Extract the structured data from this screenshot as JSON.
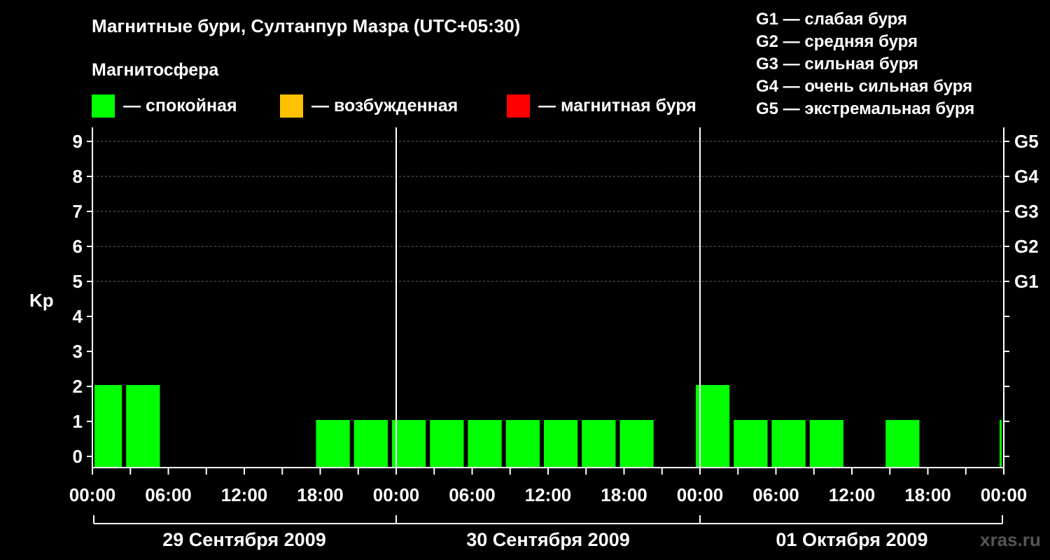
{
  "title": "Магнитные бури, Султанпур Мазра (UTC+05:30)",
  "subtitle": "Магнитосфера",
  "legend": [
    {
      "label": "— спокойная",
      "color": "#00ff00"
    },
    {
      "label": "— возбужденная",
      "color": "#ffc000"
    },
    {
      "label": "— магнитная буря",
      "color": "#ff0000"
    }
  ],
  "g_legend": [
    "G1 — слабая буря",
    "G2 — средняя буря",
    "G3 — сильная буря",
    "G4 — очень сильная буря",
    "G5 — экстремальная буря"
  ],
  "watermark": "xras.ru",
  "chart_data": {
    "type": "bar",
    "ylabel": "Kp",
    "ylim": [
      0,
      9
    ],
    "yticks": [
      0,
      1,
      2,
      3,
      4,
      5,
      6,
      7,
      8,
      9
    ],
    "right_ticks": [
      {
        "kp": 5,
        "label": "G1"
      },
      {
        "kp": 6,
        "label": "G2"
      },
      {
        "kp": 7,
        "label": "G3"
      },
      {
        "kp": 8,
        "label": "G4"
      },
      {
        "kp": 9,
        "label": "G5"
      }
    ],
    "x_tick_labels": [
      "00:00",
      "06:00",
      "12:00",
      "18:00",
      "00:00",
      "06:00",
      "12:00",
      "18:00",
      "00:00",
      "06:00",
      "12:00",
      "18:00",
      "00:00"
    ],
    "days": [
      "29 Сентября 2009",
      "30 Сентября 2009",
      "01 Октября 2009"
    ],
    "grid": true,
    "bars": [
      {
        "start_hour": 0,
        "end_hour": 2.5,
        "kp": 2
      },
      {
        "start_hour": 2.5,
        "end_hour": 5.5,
        "kp": 2
      },
      {
        "start_hour": 5.5,
        "end_hour": 8.5,
        "kp": 0
      },
      {
        "start_hour": 8.5,
        "end_hour": 11.5,
        "kp": 0
      },
      {
        "start_hour": 11.5,
        "end_hour": 14.5,
        "kp": 0
      },
      {
        "start_hour": 14.5,
        "end_hour": 17.5,
        "kp": 0
      },
      {
        "start_hour": 17.5,
        "end_hour": 20.5,
        "kp": 1
      },
      {
        "start_hour": 20.5,
        "end_hour": 23.5,
        "kp": 1
      },
      {
        "start_hour": 23.5,
        "end_hour": 26.5,
        "kp": 1
      },
      {
        "start_hour": 26.5,
        "end_hour": 29.5,
        "kp": 1
      },
      {
        "start_hour": 29.5,
        "end_hour": 32.5,
        "kp": 1
      },
      {
        "start_hour": 32.5,
        "end_hour": 35.5,
        "kp": 1
      },
      {
        "start_hour": 35.5,
        "end_hour": 38.5,
        "kp": 1
      },
      {
        "start_hour": 38.5,
        "end_hour": 41.5,
        "kp": 1
      },
      {
        "start_hour": 41.5,
        "end_hour": 44.5,
        "kp": 1
      },
      {
        "start_hour": 44.5,
        "end_hour": 47.5,
        "kp": 0
      },
      {
        "start_hour": 47.5,
        "end_hour": 50.5,
        "kp": 2
      },
      {
        "start_hour": 50.5,
        "end_hour": 53.5,
        "kp": 1
      },
      {
        "start_hour": 53.5,
        "end_hour": 56.5,
        "kp": 1
      },
      {
        "start_hour": 56.5,
        "end_hour": 59.5,
        "kp": 1
      },
      {
        "start_hour": 59.5,
        "end_hour": 62.5,
        "kp": 0
      },
      {
        "start_hour": 62.5,
        "end_hour": 65.5,
        "kp": 1
      },
      {
        "start_hour": 65.5,
        "end_hour": 68.5,
        "kp": 0
      },
      {
        "start_hour": 68.5,
        "end_hour": 71.5,
        "kp": 0
      },
      {
        "start_hour": 71.5,
        "end_hour": 72,
        "kp": 1
      }
    ]
  }
}
